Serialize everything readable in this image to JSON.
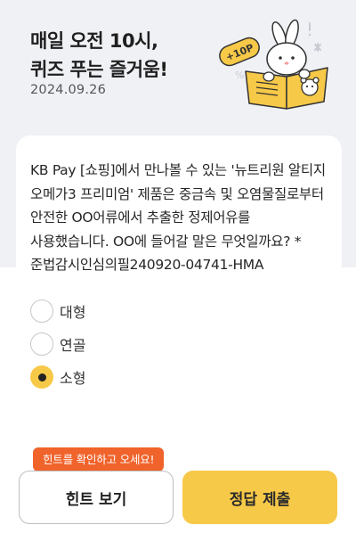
{
  "header": {
    "headline": "매일 오전 10시,\n퀴즈 푸는 즐거움!",
    "date": "2024.09.26",
    "badge": "+10P"
  },
  "question": {
    "text": "KB Pay [쇼핑]에서 만나볼 수 있는 '뉴트리원 알티지 오메가3 프리미엄' 제품은 중금속 및 오염물질로부터 안전한 OO어류에서 추출한 정제어유를 사용했습니다. OO에 들어갈 말은 무엇일까요? * 준법감시인심의필240920-04741-HMA"
  },
  "options": [
    {
      "label": "대형",
      "selected": false
    },
    {
      "label": "연골",
      "selected": false
    },
    {
      "label": "소형",
      "selected": true
    }
  ],
  "hint_tooltip": "힌트를 확인하고 오세요!",
  "buttons": {
    "hint": "힌트 보기",
    "submit": "정답 제출"
  },
  "colors": {
    "accent": "#f7c948",
    "tooltip": "#f0632b",
    "header_bg": "#f0f1f5"
  }
}
